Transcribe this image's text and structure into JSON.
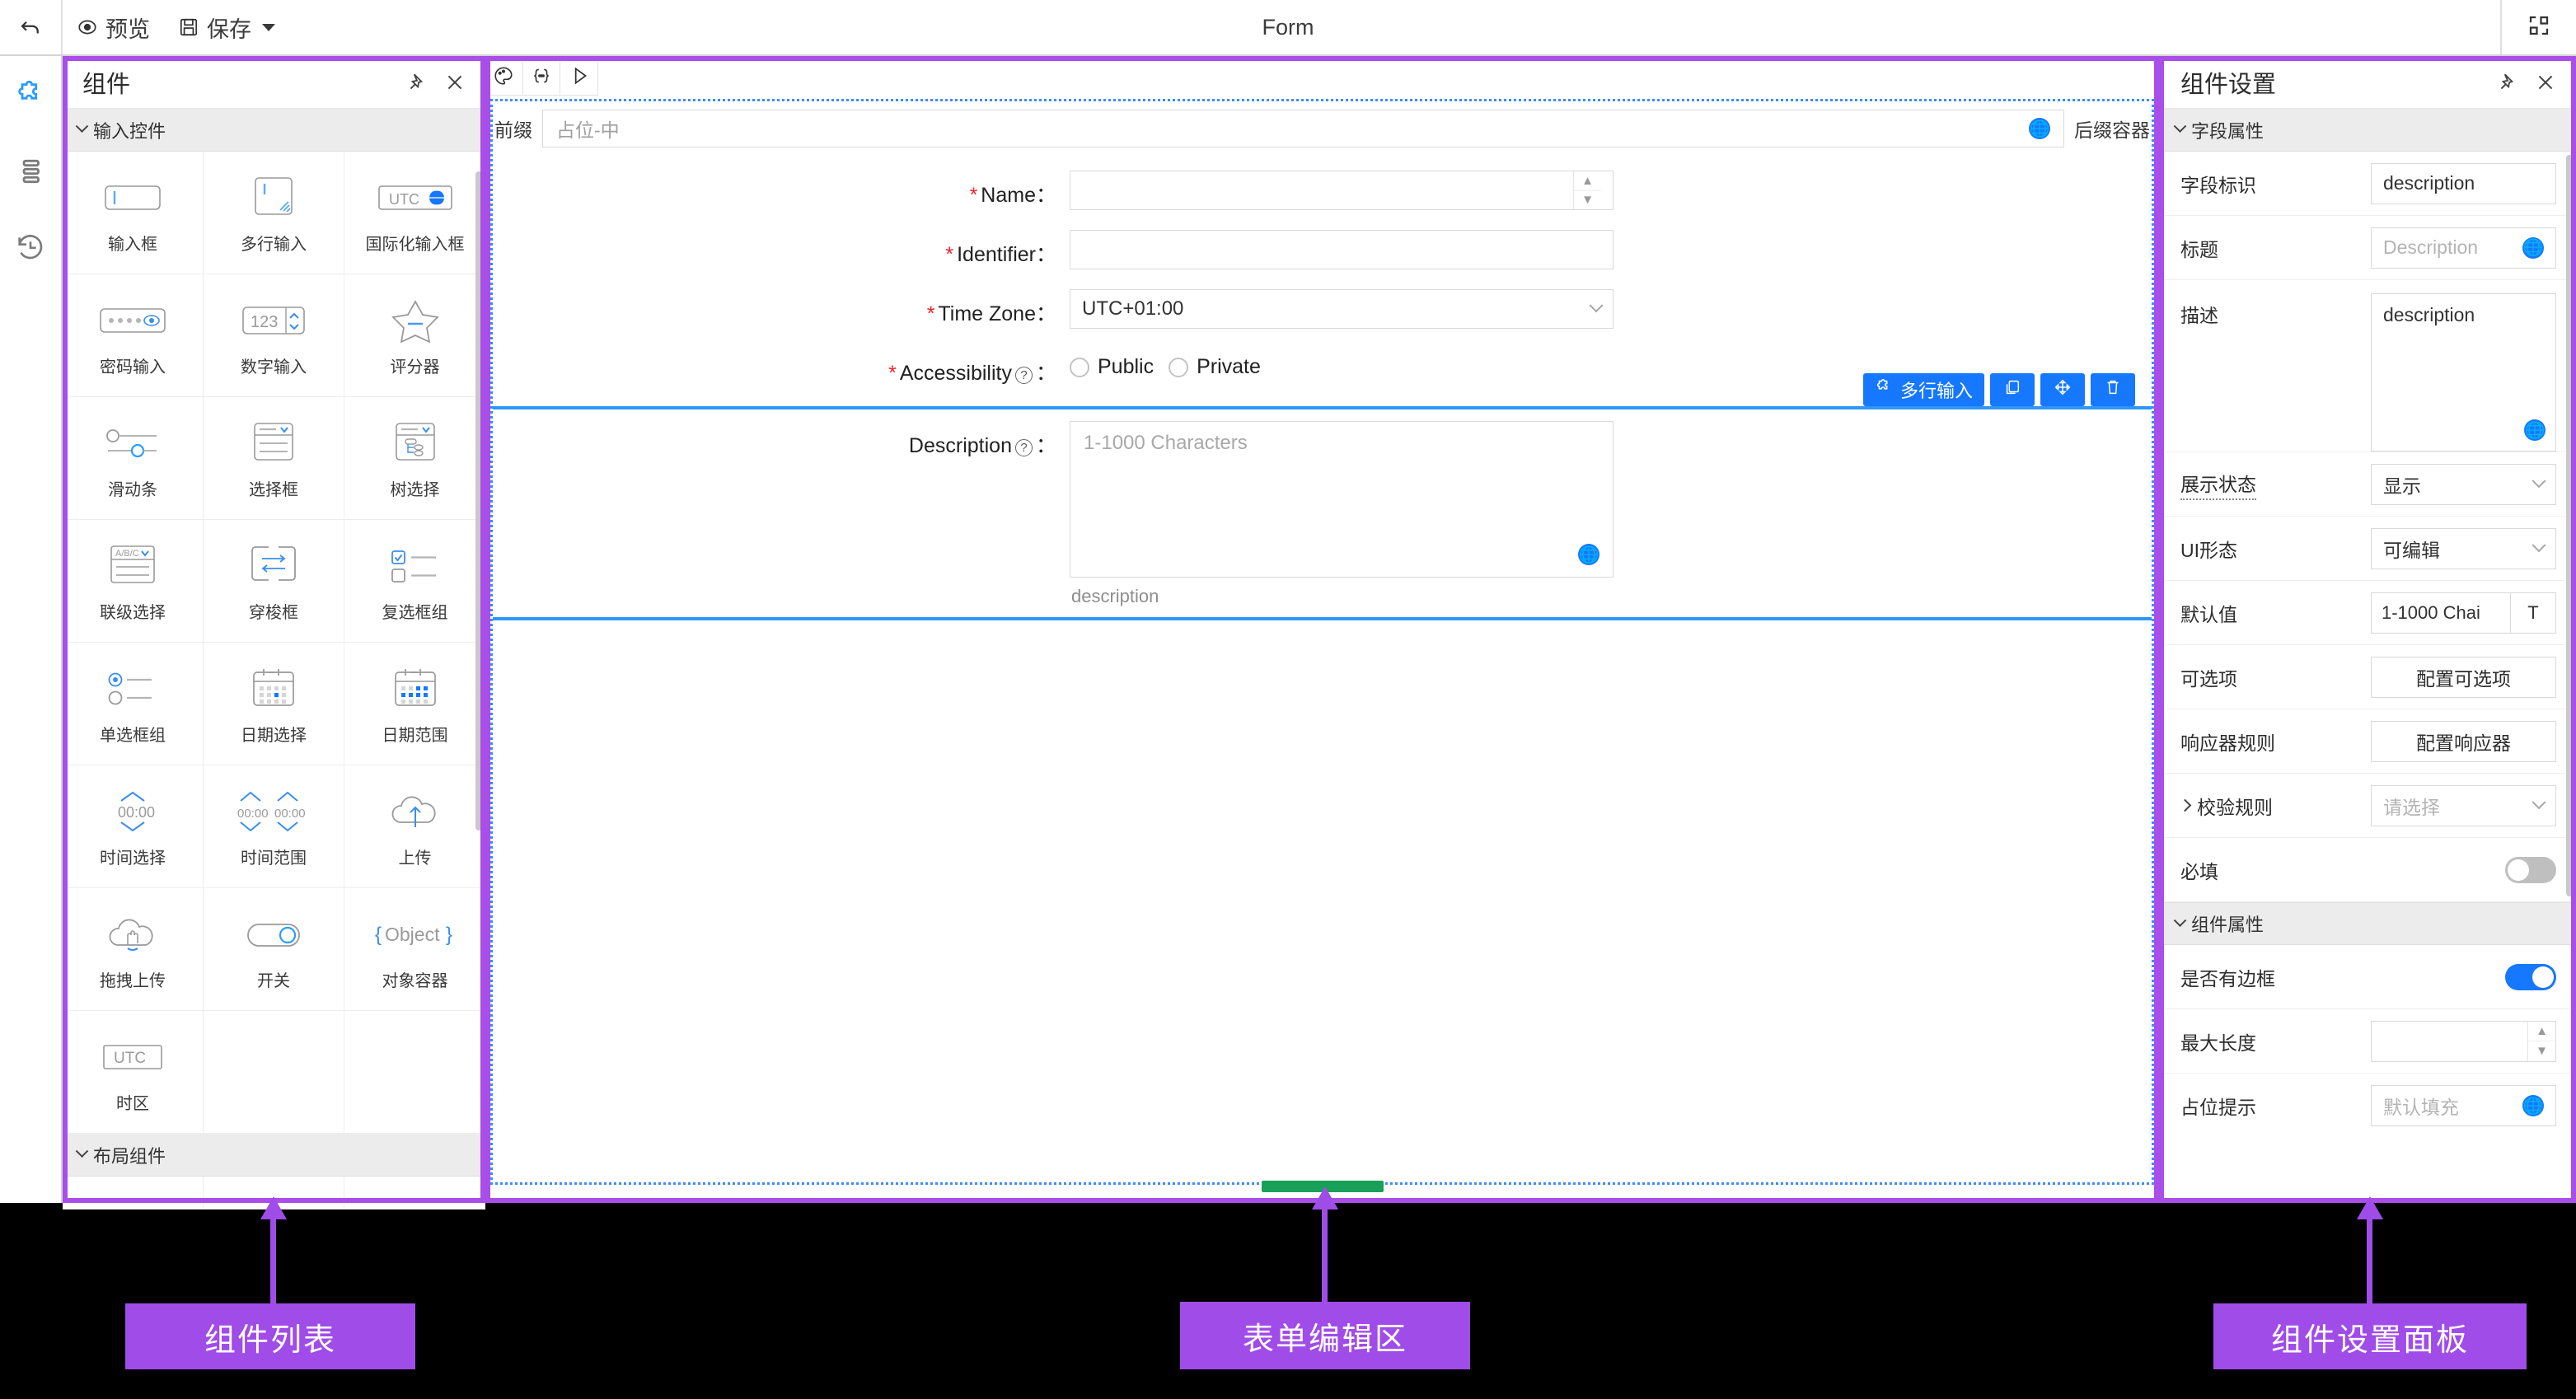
{
  "topbar": {
    "undo_icon": "undo-arrow-icon",
    "preview_label": "预览",
    "preview_icon": "eye-icon",
    "save_label": "保存",
    "save_icon": "floppy-disk-icon",
    "title": "Form",
    "fullscreen_icon": "expand-fullscreen-icon"
  },
  "rail": {
    "items": [
      {
        "name": "components",
        "icon": "puzzle-piece-icon",
        "active": true
      },
      {
        "name": "outline",
        "icon": "layers-list-icon",
        "active": false
      },
      {
        "name": "history",
        "icon": "history-clock-icon",
        "active": false
      }
    ]
  },
  "left_panel": {
    "title": "组件",
    "pin_icon": "pin-icon",
    "close_icon": "close-icon",
    "groups": [
      {
        "label": "输入控件",
        "expanded": true
      },
      {
        "label": "布局组件",
        "expanded": true
      }
    ],
    "components": [
      {
        "label": "输入框",
        "icon": "text-input-icon"
      },
      {
        "label": "多行输入",
        "icon": "textarea-icon"
      },
      {
        "label": "国际化输入框",
        "icon": "i18n-input-icon",
        "badge": "UTC"
      },
      {
        "label": "密码输入",
        "icon": "password-input-icon"
      },
      {
        "label": "数字输入",
        "icon": "number-input-icon",
        "badge": "123"
      },
      {
        "label": "评分器",
        "icon": "star-rate-icon"
      },
      {
        "label": "滑动条",
        "icon": "slider-icon"
      },
      {
        "label": "选择框",
        "icon": "select-icon"
      },
      {
        "label": "树选择",
        "icon": "tree-select-icon"
      },
      {
        "label": "联级选择",
        "icon": "cascader-icon",
        "badge": "A/B/C"
      },
      {
        "label": "穿梭框",
        "icon": "transfer-icon"
      },
      {
        "label": "复选框组",
        "icon": "checkbox-group-icon"
      },
      {
        "label": "单选框组",
        "icon": "radio-group-icon"
      },
      {
        "label": "日期选择",
        "icon": "date-picker-icon"
      },
      {
        "label": "日期范围",
        "icon": "date-range-icon"
      },
      {
        "label": "时间选择",
        "icon": "time-picker-icon",
        "badge": "00:00"
      },
      {
        "label": "时间范围",
        "icon": "time-range-icon",
        "badge": "00:00 00:00"
      },
      {
        "label": "上传",
        "icon": "cloud-upload-icon"
      },
      {
        "label": "拖拽上传",
        "icon": "drag-upload-icon"
      },
      {
        "label": "开关",
        "icon": "switch-icon"
      },
      {
        "label": "对象容器",
        "icon": "object-container-icon",
        "badge": "{Object}"
      },
      {
        "label": "时区",
        "icon": "timezone-icon",
        "badge": "UTC"
      }
    ]
  },
  "editor": {
    "toolbar": [
      {
        "name": "theme",
        "icon": "palette-icon"
      },
      {
        "name": "variables",
        "icon": "braces-icon"
      },
      {
        "name": "run",
        "icon": "play-triangle-icon"
      }
    ],
    "prefix_label": "前缀",
    "prefix_placeholder": "占位-中",
    "suffix_label": "后缀容器",
    "globe_icon": "globe-i18n-icon",
    "fields": [
      {
        "label": "Name",
        "required": true,
        "value": "",
        "control": "input-spinner"
      },
      {
        "label": "Identifier",
        "required": true,
        "value": "",
        "control": "input"
      },
      {
        "label": "Time Zone",
        "required": true,
        "value": "UTC+01:00",
        "control": "select"
      }
    ],
    "accessibility": {
      "label": "Accessibility",
      "required": true,
      "help_icon": "question-mark-icon",
      "options": [
        "Public",
        "Private"
      ]
    },
    "description_field": {
      "label": "Description",
      "help_icon": "question-mark-icon",
      "placeholder": "1-1000 Characters",
      "hint": "description",
      "globe_icon": "globe-i18n-icon",
      "selection_toolbar": {
        "type_label": "多行输入",
        "type_icon": "component-tag-icon",
        "buttons": [
          {
            "name": "copy",
            "icon": "copy-icon"
          },
          {
            "name": "move",
            "icon": "move-arrows-icon"
          },
          {
            "name": "delete",
            "icon": "trash-icon"
          }
        ]
      }
    },
    "resize_handle": "drag-resize-handle"
  },
  "right_panel": {
    "title": "组件设置",
    "pin_icon": "pin-icon",
    "close_icon": "close-icon",
    "sections": [
      {
        "label": "字段属性",
        "expanded": true,
        "rows": [
          {
            "key": "字段标识",
            "type": "text",
            "value": "description"
          },
          {
            "key": "标题",
            "type": "text-i18n",
            "placeholder": "Description",
            "globe_icon": "globe-i18n-icon"
          },
          {
            "key": "描述",
            "type": "textarea-i18n",
            "value": "description",
            "globe_icon": "globe-i18n-icon"
          },
          {
            "key": "展示状态",
            "type": "select",
            "value": "显示",
            "dotted": true
          },
          {
            "key": "UI形态",
            "type": "select",
            "value": "可编辑"
          },
          {
            "key": "默认值",
            "type": "text-addon",
            "value": "1-1000 Chai",
            "addon": "T"
          },
          {
            "key": "可选项",
            "type": "button",
            "value": "配置可选项"
          },
          {
            "key": "响应器规则",
            "type": "button",
            "value": "配置响应器"
          },
          {
            "key": "校验规则",
            "type": "select",
            "placeholder": "请选择",
            "collapsible": true
          },
          {
            "key": "必填",
            "type": "toggle",
            "on": false
          }
        ]
      },
      {
        "label": "组件属性",
        "expanded": true,
        "rows": [
          {
            "key": "是否有边框",
            "type": "toggle",
            "on": true
          },
          {
            "key": "最大长度",
            "type": "number",
            "value": ""
          },
          {
            "key": "占位提示",
            "type": "text-i18n",
            "placeholder": "默认填充",
            "globe_icon": "globe-i18n-icon"
          }
        ]
      }
    ]
  },
  "annotations": [
    {
      "label": "组件列表",
      "target": "left-components-panel"
    },
    {
      "label": "表单编辑区",
      "target": "center-form-editor"
    },
    {
      "label": "组件设置面板",
      "target": "right-settings-panel"
    }
  ],
  "colors": {
    "annotation": "#a04ce8",
    "primary_blue": "#1677ff",
    "selection_blue": "#2e97f7",
    "required_red": "#f5222d",
    "resize_green": "#18a058"
  }
}
